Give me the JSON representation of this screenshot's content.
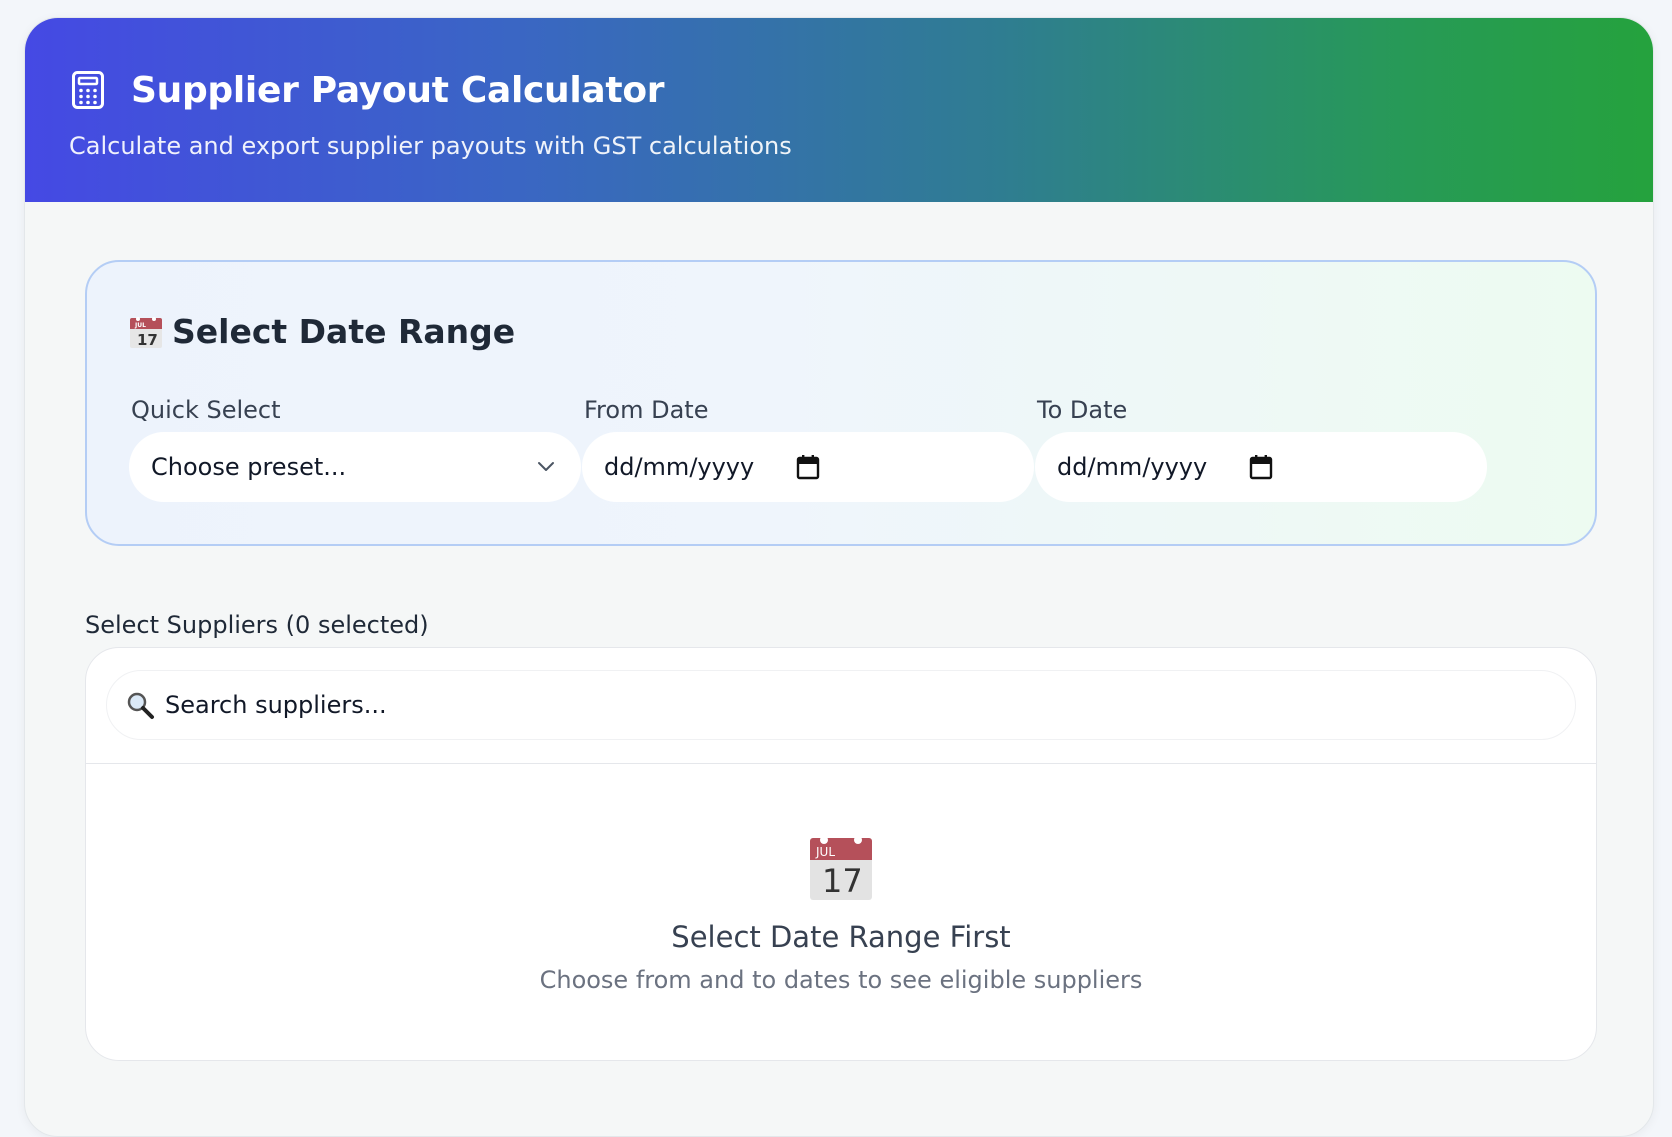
{
  "header": {
    "icon": "calculator-icon",
    "title": "Supplier Payout Calculator",
    "subtitle": "Calculate and export supplier payouts with GST calculations",
    "gradient": [
      "#4549e4",
      "#25a23d"
    ]
  },
  "date_range": {
    "icon": "calendar-emoji-icon",
    "title": "Select Date Range",
    "quick_select": {
      "label": "Quick Select",
      "value": "Choose preset..."
    },
    "from_date": {
      "label": "From Date",
      "placeholder": "dd/mm/yyyy"
    },
    "to_date": {
      "label": "To Date",
      "placeholder": "dd/mm/yyyy"
    }
  },
  "suppliers": {
    "label": "Select Suppliers (0 selected)",
    "search": {
      "icon": "search-icon",
      "placeholder": "Search suppliers..."
    },
    "empty_state": {
      "icon": "calendar-emoji-icon",
      "title": "Select Date Range First",
      "description": "Choose from and to dates to see eligible suppliers"
    }
  }
}
